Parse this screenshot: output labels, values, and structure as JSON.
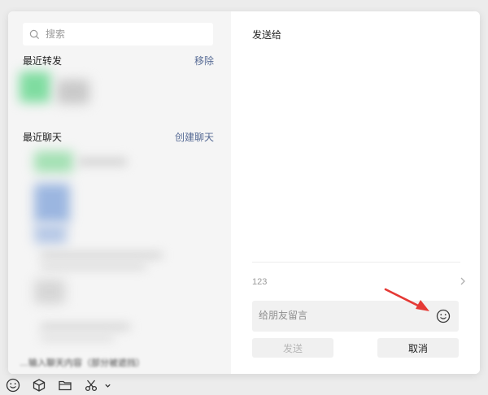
{
  "search": {
    "placeholder": "搜索"
  },
  "recent_forward": {
    "title": "最近转发",
    "action": "移除"
  },
  "recent_chats": {
    "title": "最近聊天",
    "action": "创建聊天"
  },
  "send_to": {
    "label": "发送给"
  },
  "message_preview": "123",
  "message_input": {
    "placeholder": "给朋友留言"
  },
  "buttons": {
    "send": "发送",
    "cancel": "取消"
  },
  "partial_hint": "…输入聊天内容（部分被遮挡）",
  "icons": [
    "search-icon",
    "chevron-right-icon",
    "emoji-icon",
    "arrow-annotation",
    "toolbar-emoji-icon",
    "toolbar-cube-icon",
    "toolbar-folder-icon",
    "toolbar-scissors-icon",
    "toolbar-chevron-down-icon"
  ],
  "colors": {
    "link": "#576b95",
    "annotation": "#e53935"
  }
}
